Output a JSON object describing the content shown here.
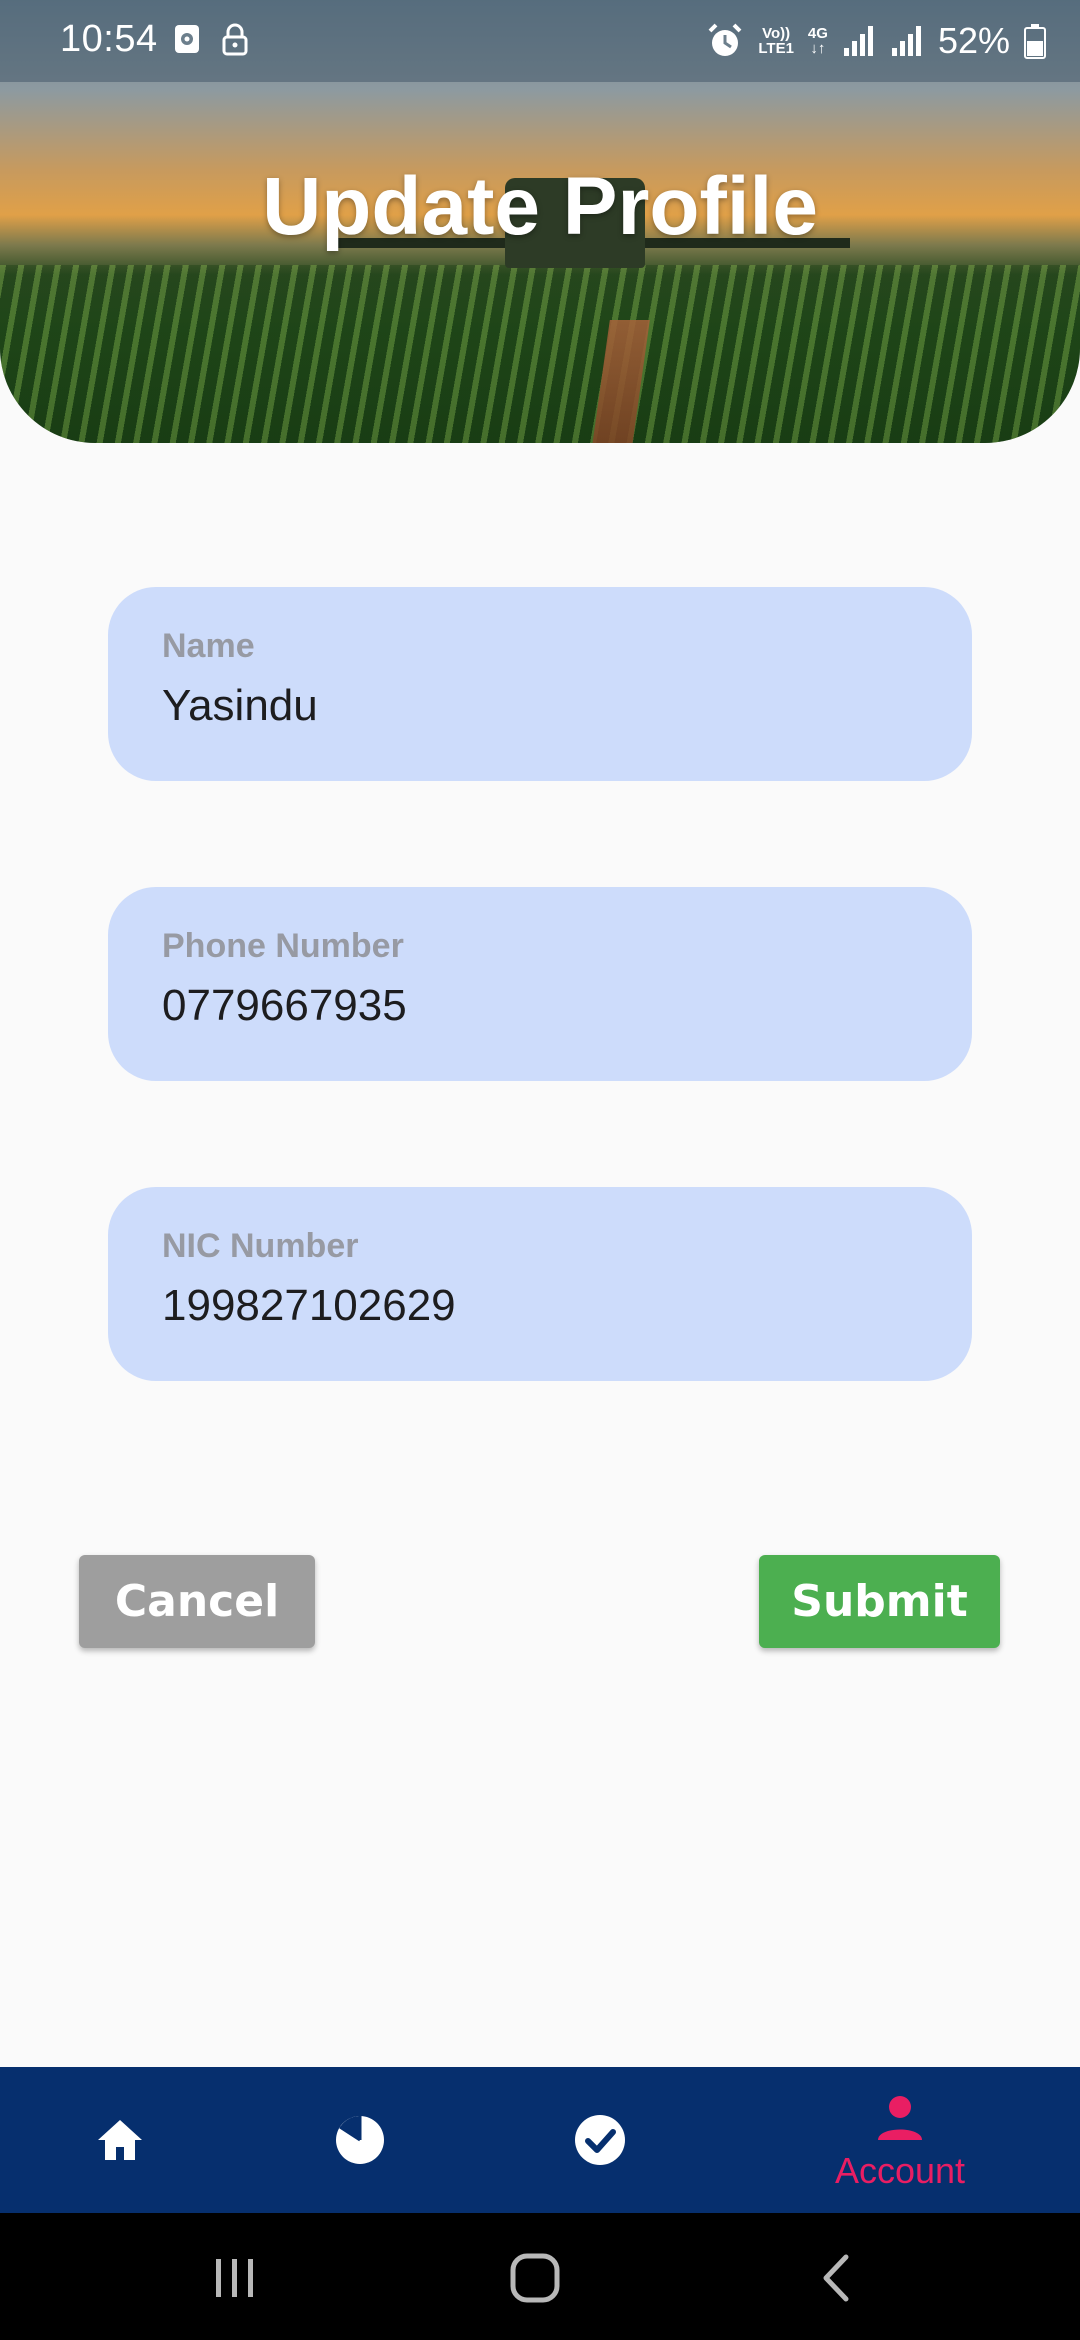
{
  "status_bar": {
    "time": "10:54",
    "battery": "52%",
    "network_top": "Vo))",
    "network_bottom": "LTE1",
    "network_type": "4G",
    "icons": [
      "screen-record-icon",
      "lock-icon",
      "alarm-icon",
      "volte-icon",
      "data-arrows-icon",
      "signal-icon",
      "signal-icon",
      "battery-icon"
    ]
  },
  "header": {
    "title": "Update Profile"
  },
  "form": {
    "fields": [
      {
        "label": "Name",
        "value": "Yasindu"
      },
      {
        "label": "Phone Number",
        "value": "0779667935"
      },
      {
        "label": "NIC Number",
        "value": "199827102629"
      }
    ]
  },
  "actions": {
    "cancel_label": "Cancel",
    "submit_label": "Submit"
  },
  "bottom_nav": {
    "items": [
      {
        "icon": "home-icon",
        "label": ""
      },
      {
        "icon": "pie-chart-icon",
        "label": ""
      },
      {
        "icon": "check-circle-icon",
        "label": ""
      },
      {
        "icon": "person-icon",
        "label": "Account"
      }
    ],
    "active_index": 3
  },
  "colors": {
    "field_background": "#cddcfb",
    "cancel": "#9e9e9e",
    "submit": "#4caf50",
    "nav_background": "#062f6e",
    "nav_active": "#e91e63"
  }
}
